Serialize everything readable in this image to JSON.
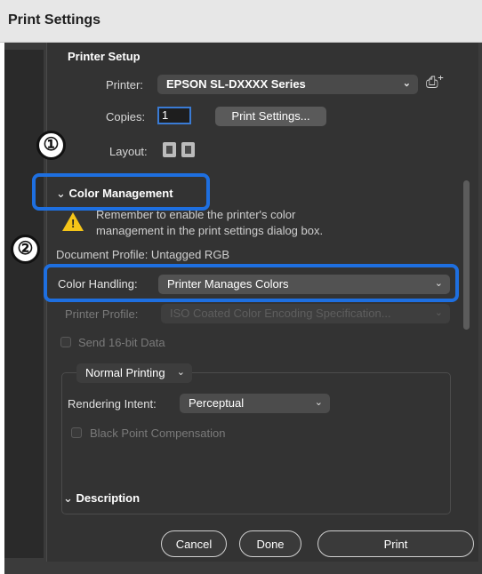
{
  "window": {
    "title": "Print Settings"
  },
  "printer_setup": {
    "heading": "Printer Setup",
    "printer_label": "Printer:",
    "printer_value": "EPSON SL-DXXXX Series",
    "copies_label": "Copies:",
    "copies_value": "1",
    "print_settings_button": "Print Settings...",
    "layout_label": "Layout:"
  },
  "color_management": {
    "heading": "Color Management",
    "warning_line1": "Remember to enable the printer's color",
    "warning_line2": "management in the print settings dialog box.",
    "document_profile": "Document Profile: Untagged RGB",
    "color_handling_label": "Color Handling:",
    "color_handling_value": "Printer Manages Colors",
    "printer_profile_label": "Printer Profile:",
    "printer_profile_value": "ISO Coated Color Encoding Specification...",
    "send_16bit_label": "Send 16-bit Data",
    "normal_printing": "Normal Printing",
    "rendering_intent_label": "Rendering Intent:",
    "rendering_intent_value": "Perceptual",
    "black_point_label": "Black Point Compensation"
  },
  "description": {
    "heading": "Description"
  },
  "footer": {
    "cancel": "Cancel",
    "done": "Done",
    "print": "Print"
  },
  "callouts": {
    "one": "①",
    "two": "②"
  },
  "colors": {
    "callout": "#1e6fe0",
    "panel": "#333333",
    "warning": "#f5c518"
  }
}
